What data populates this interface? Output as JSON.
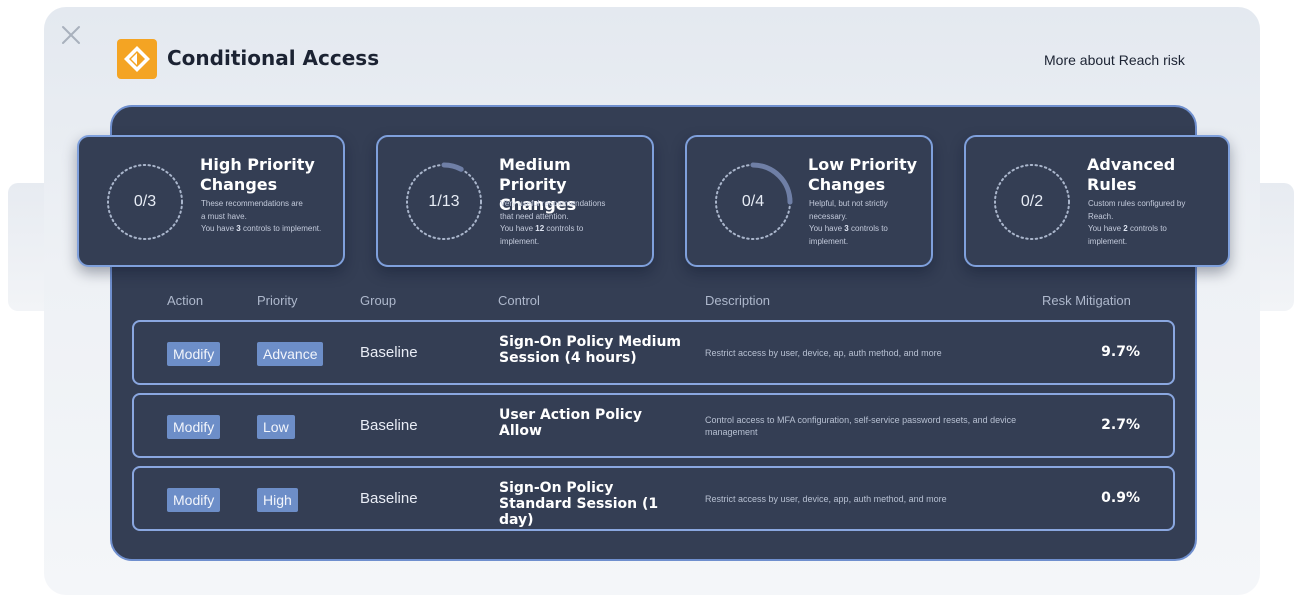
{
  "header": {
    "title": "Conditional Access",
    "more_link": "More about Reach risk"
  },
  "cards": [
    {
      "ring": "0/3",
      "progress": 0.0,
      "title": "High Priority Changes",
      "desc": [
        "These recommendations are",
        "a must have."
      ],
      "controls_prefix": "You have ",
      "controls_count": "3",
      "controls_suffix": " controls to implement."
    },
    {
      "ring": "1/13",
      "progress": 0.077,
      "title": "Medium Priority Changes",
      "desc": [
        "Very useful recommendations",
        "that need attention."
      ],
      "controls_prefix": "You have ",
      "controls_count": "12",
      "controls_suffix": " controls to implement."
    },
    {
      "ring": "0/4",
      "progress": 0.25,
      "title": "Low Priority Changes",
      "desc": [
        "Helpful, but not strictly",
        "necessary."
      ],
      "controls_prefix": "You have ",
      "controls_count": "3",
      "controls_suffix": " controls to implement."
    },
    {
      "ring": "0/2",
      "progress": 0.0,
      "title": "Advanced Rules",
      "desc": [
        "Custom rules configured by",
        "Reach."
      ],
      "controls_prefix": "You have ",
      "controls_count": "2",
      "controls_suffix": " controls to implement."
    }
  ],
  "table": {
    "headers": [
      "Action",
      "Priority",
      "Group",
      "Control",
      "Description",
      "Resk Mitigation"
    ],
    "rows": [
      {
        "action": "Modify",
        "priority": "Advance",
        "group": "Baseline",
        "control": "Sign-On Policy Medium Session (4 hours)",
        "description": "Restrict access by user, device, ap, auth method, and more",
        "risk": "9.7%"
      },
      {
        "action": "Modify",
        "priority": "Low",
        "group": "Baseline",
        "control": "User Action Policy Allow",
        "description": "Control access to MFA configuration, self-service password resets, and device management",
        "risk": "2.7%"
      },
      {
        "action": "Modify",
        "priority": "High",
        "group": "Baseline",
        "control": "Sign-On Policy Standard Session (1 day)",
        "description": "Restrict access by user, device, app, auth method, and more",
        "risk": "0.9%"
      }
    ]
  },
  "colors": {
    "panel": "#343e54",
    "accent": "#f4a423",
    "chip": "#6d8ec8",
    "border": "#8aa7e0"
  },
  "icons": {
    "close": "close-icon",
    "logo": "reach-logo-icon"
  }
}
